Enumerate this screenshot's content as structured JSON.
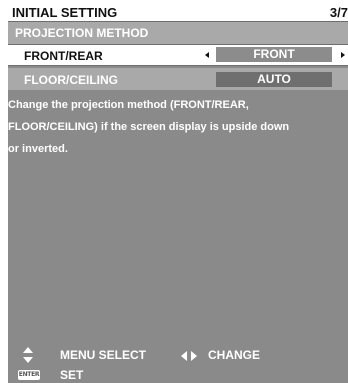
{
  "header": {
    "title": "INITIAL SETTING",
    "page": "3/7"
  },
  "section": {
    "title": "PROJECTION METHOD"
  },
  "settings": [
    {
      "label": "FRONT/REAR",
      "value": "FRONT",
      "selected": true
    },
    {
      "label": "FLOOR/CEILING",
      "value": "AUTO",
      "selected": false
    }
  ],
  "help": {
    "text": "Change the projection method (FRONT/REAR,\nFLOOR/CEILING) if the screen display is upside down\nor inverted."
  },
  "footer": {
    "menu_select": "MENU SELECT",
    "change": "CHANGE",
    "enter_key": "ENTER",
    "set": "SET"
  },
  "icons": {
    "updown": "updown-arrows-icon",
    "leftright": "leftright-arrows-icon",
    "enter": "enter-key-icon",
    "left_arrow": "left-arrow-icon",
    "right_arrow": "right-arrow-icon"
  },
  "colors": {
    "background": "#8a8a8a",
    "header_bg": "#ffffff",
    "section_bg": "#a9a9a9",
    "selected_row_bg": "#ffffff",
    "value_box": "#8c8c8c",
    "value_box_dim": "#6f6f6f",
    "text_light": "#ffffff",
    "text_dark": "#111111"
  }
}
